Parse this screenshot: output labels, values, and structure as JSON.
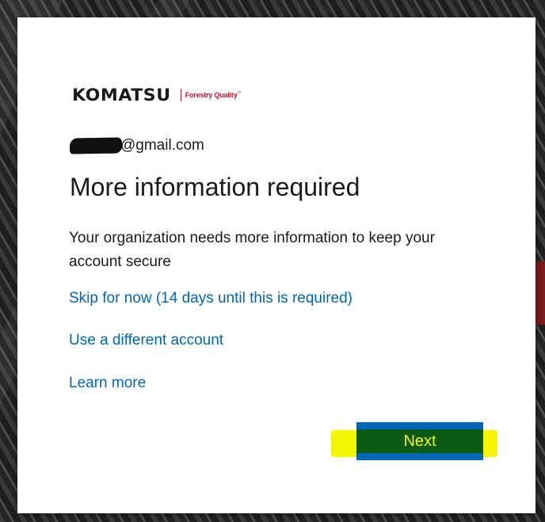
{
  "brand": {
    "name": "KOMATSU",
    "tagline": "Forestry Quality",
    "tagline_mark": "™"
  },
  "account": {
    "email_suffix": "@gmail.com"
  },
  "heading": "More information required",
  "description": "Your organization needs more information to keep your account secure",
  "links": {
    "skip": "Skip for now (14 days until this is required)",
    "different_account": "Use a different account",
    "learn_more": "Learn more"
  },
  "buttons": {
    "next": "Next"
  },
  "colors": {
    "link": "#0067b8",
    "button": "#0067b8",
    "brand_red": "#d0102a",
    "highlight": "#f5f500"
  }
}
